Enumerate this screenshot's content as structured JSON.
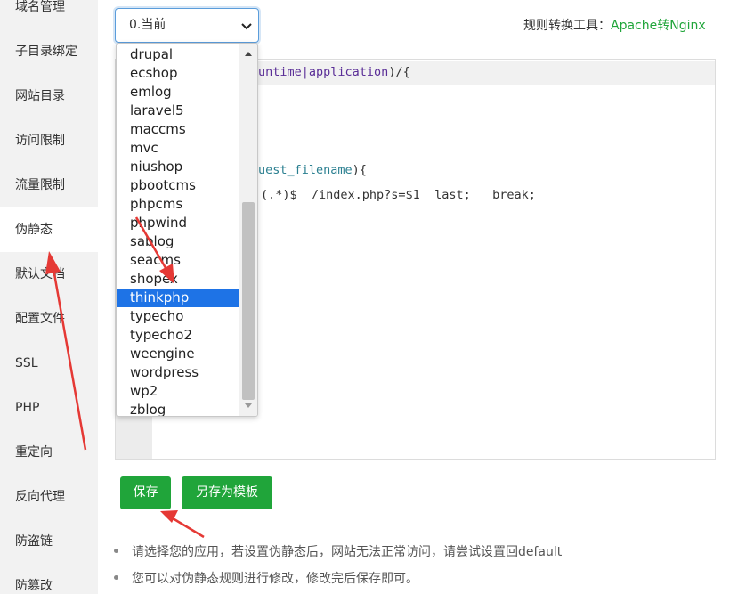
{
  "sidebar": {
    "items": [
      {
        "label": "域名管理"
      },
      {
        "label": "子目录绑定"
      },
      {
        "label": "网站目录"
      },
      {
        "label": "访问限制"
      },
      {
        "label": "流量限制"
      },
      {
        "label": "伪静态"
      },
      {
        "label": "默认文档"
      },
      {
        "label": "配置文件"
      },
      {
        "label": "SSL"
      },
      {
        "label": "PHP"
      },
      {
        "label": "重定向"
      },
      {
        "label": "反向代理"
      },
      {
        "label": "防盗链"
      },
      {
        "label": "防篡改"
      }
    ],
    "active": "伪静态"
  },
  "rewrite_select": {
    "selected": "0.当前",
    "options": [
      "drupal",
      "ecshop",
      "emlog",
      "laravel5",
      "maccms",
      "mvc",
      "niushop",
      "pbootcms",
      "phpcms",
      "phpwind",
      "sablog",
      "seacms",
      "shopex",
      "thinkphp",
      "typecho",
      "typecho2",
      "weengine",
      "wordpress",
      "wp2",
      "zblog"
    ],
    "highlighted": "thinkphp"
  },
  "tool": {
    "label": "规则转换工具：",
    "link": "Apache转Nginx"
  },
  "editor": {
    "line1_kw": "untime|application",
    "line1_tail": ")/{",
    "line2_var": "uest_filename",
    "line2_tail": "){",
    "line3": "(.*)$  /index.php?s=$1  last;   break;"
  },
  "buttons": {
    "save": "保存",
    "save_template": "另存为模板"
  },
  "tips": [
    "请选择您的应用，若设置伪静态后，网站无法正常访问，请尝试设置回default",
    "您可以对伪静态规则进行修改，修改完后保存即可。"
  ],
  "colors": {
    "accent_green": "#20a53a",
    "selection_blue": "#1e73e6",
    "annotation_red": "#e53935"
  }
}
